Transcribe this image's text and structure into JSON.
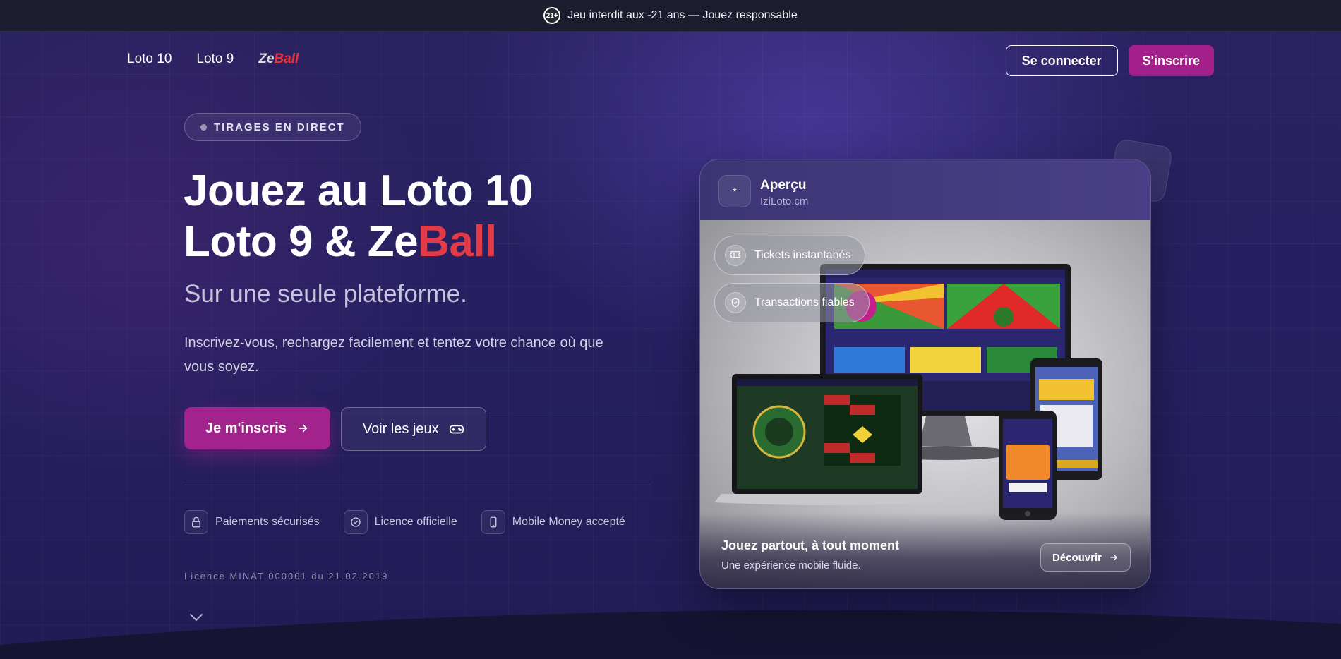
{
  "topbar": {
    "age_badge": "21+",
    "notice": "Jeu interdit aux -21 ans — Jouez responsable"
  },
  "nav": {
    "links": [
      "Loto 10",
      "Loto 9"
    ],
    "zeball_ze": "Ze",
    "zeball_ball": "Ball",
    "login": "Se connecter",
    "signup": "S'inscrire"
  },
  "hero": {
    "live_label": "TIRAGES EN DIRECT",
    "headline_line1": "Jouez au Loto 10",
    "headline_line2_a": "Loto 9 & Ze",
    "headline_line2_b": "Ball",
    "subhead": "Sur une seule plateforme.",
    "description": "Inscrivez-vous, rechargez facilement et tentez votre chance où que vous soyez.",
    "cta_primary": "Je m'inscris",
    "cta_secondary": "Voir les jeux",
    "features": [
      {
        "label": "Paiements sécurisés",
        "icon": "lock-icon"
      },
      {
        "label": "Licence officielle",
        "icon": "check-badge-icon"
      },
      {
        "label": "Mobile Money accepté",
        "icon": "phone-icon"
      }
    ],
    "license": "Licence MINAT 000001 du 21.02.2019"
  },
  "preview_card": {
    "avatar": "*",
    "title": "Aperçu",
    "subtitle": "IziLoto.cm",
    "pills": [
      {
        "label": "Tickets instantanés",
        "icon": "ticket-icon"
      },
      {
        "label": "Transactions fiables",
        "icon": "shield-check-icon"
      }
    ],
    "footer_title": "Jouez partout, à tout moment",
    "footer_subtitle": "Une expérience mobile fluide.",
    "discover": "Découvrir"
  },
  "colors": {
    "accent": "#a3208a",
    "zeball_red": "#e23a46",
    "background": "#262060"
  }
}
